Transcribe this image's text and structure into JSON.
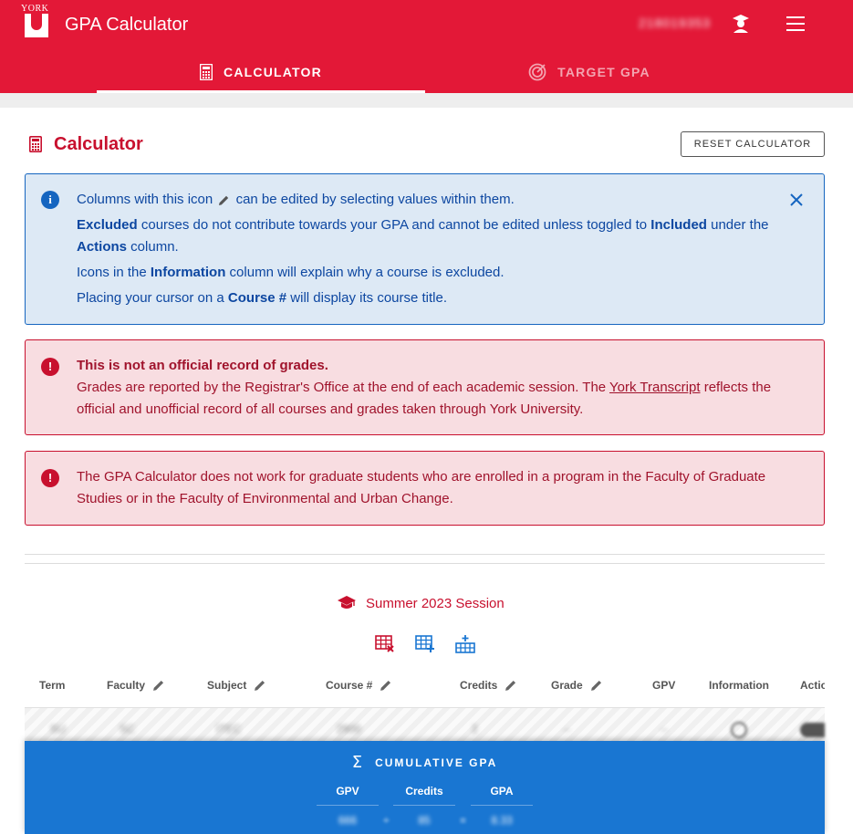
{
  "header": {
    "logo_text": "YORK",
    "app_title": "GPA Calculator",
    "student_id": "218019353",
    "tabs": [
      {
        "label": "CALCULATOR",
        "active": true
      },
      {
        "label": "TARGET GPA",
        "active": false
      }
    ],
    "brand_color": "#e31837"
  },
  "calculator": {
    "title": "Calculator",
    "reset_label": "RESET CALCULATOR"
  },
  "info_alert": {
    "line1_pre": "Columns with this icon",
    "line1_post": "can be edited by selecting values within them.",
    "line2_b1": "Excluded",
    "line2_t1": " courses do not contribute towards your GPA and cannot be edited unless toggled to ",
    "line2_b2": "Included",
    "line2_t2": " under the ",
    "line2_b3": "Actions",
    "line2_t3": " column.",
    "line3_t1": "Icons in the ",
    "line3_b1": "Information",
    "line3_t2": " column will explain why a course is excluded.",
    "line4_t1": "Placing your cursor on a ",
    "line4_b1": "Course #",
    "line4_t2": " will display its course title."
  },
  "warning_alert": {
    "heading": "This is not an official record of grades.",
    "text_pre": "Grades are reported by the Registrar's Office at the end of each academic session. The ",
    "link": "York Transcript",
    "text_post": " reflects the official and unofficial record of all courses and grades taken through York University."
  },
  "grad_alert": {
    "text": "The GPA Calculator does not work for graduate students who are enrolled in a program in the Faculty of Graduate Studies or in the Faculty of Environmental and Urban Change."
  },
  "session": {
    "title": "Summer 2023 Session",
    "columns": [
      "Term",
      "Faculty",
      "Subject",
      "Course #",
      "Credits",
      "Grade",
      "GPV",
      "Information",
      "Actio"
    ],
    "row": {
      "term": "SU",
      "faculty": "SC",
      "subject": "ITEC",
      "course": "2900",
      "credits": "2",
      "grade": "--",
      "gpv": "--"
    }
  },
  "cumulative": {
    "title": "CUMULATIVE GPA",
    "headers": [
      "GPV",
      "Credits",
      "GPA"
    ],
    "values": [
      "666",
      "85",
      "8.33"
    ],
    "op1": "÷",
    "op2": "="
  }
}
